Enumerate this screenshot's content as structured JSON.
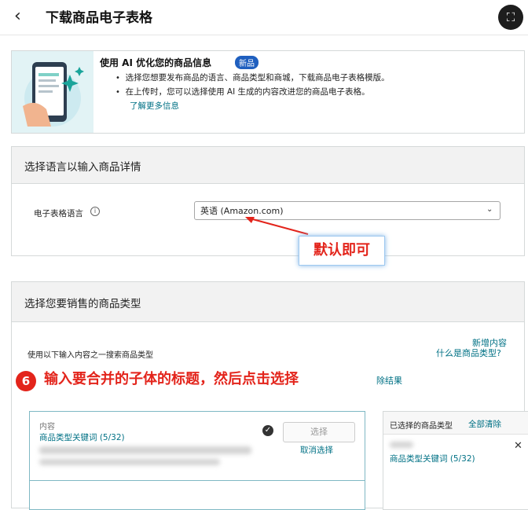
{
  "header": {
    "back_icon": "chevron-left-icon",
    "title": "下载商品电子表格",
    "scan_icon": "scan-icon"
  },
  "info_card": {
    "title": "使用 AI 优化您的商品信息",
    "badge": "新品",
    "bullets": [
      "选择您想要发布商品的语言、商品类型和商城，下载商品电子表格模版。",
      "在上传时，您可以选择使用 AI 生成的内容改进您的商品电子表格。"
    ],
    "learn_more": "了解更多信息"
  },
  "language_section": {
    "heading": "选择语言以输入商品详情",
    "label": "电子表格语言",
    "selected": "英语 (Amazon.com)"
  },
  "type_section": {
    "heading": "选择您要销售的商品类型",
    "search_label": "使用以下输入内容之一搜索商品类型",
    "add_content": "新增内容",
    "what_is": "什么是商品类型?",
    "results_tail": "除结果",
    "result": {
      "name": "内容",
      "keyword": "商品类型关键词 (5/32)",
      "select_label": "选择",
      "cancel_label": "取消选择"
    },
    "selected_panel": {
      "title": "已选择的商品类型",
      "clear_all": "全部清除",
      "keyword": "商品类型关键词 (5/32)"
    }
  },
  "annotations": {
    "callout": "默认即可",
    "step_number": "6",
    "step_text": "输入要合并的子体的标题，然后点击选择"
  },
  "colors": {
    "link": "#007185",
    "badge": "#1f5fbf",
    "annotation_red": "#e3241b"
  }
}
